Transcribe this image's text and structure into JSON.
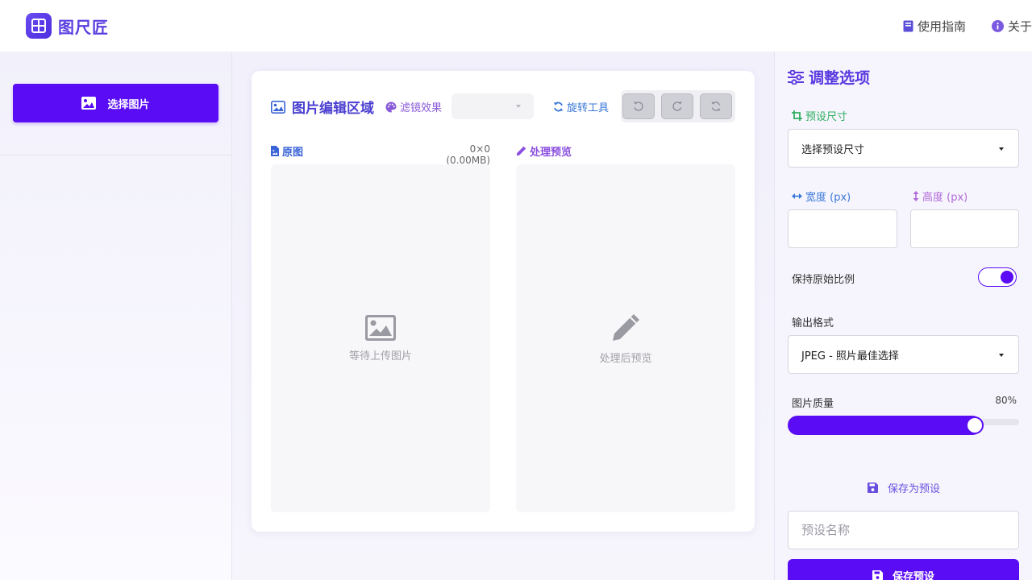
{
  "app": {
    "title": "图尺匠"
  },
  "nav": {
    "guide": "使用指南",
    "about": "关于"
  },
  "sidebar": {
    "select_image": "选择图片"
  },
  "editor": {
    "title": "图片编辑区域",
    "filter_label": "滤镜效果",
    "filter_value": "",
    "rotate_label": "旋转工具",
    "original": {
      "label": "原图",
      "info": "0×0 (0.00MB)",
      "placeholder": "等待上传图片"
    },
    "preview": {
      "label": "处理预览",
      "placeholder": "处理后预览"
    }
  },
  "options": {
    "title": "调整选项",
    "preset_size": {
      "label": "预设尺寸",
      "value": "选择预设尺寸"
    },
    "width": {
      "label": "宽度 (px)",
      "value": ""
    },
    "height": {
      "label": "高度 (px)",
      "value": ""
    },
    "keep_ratio": {
      "label": "保持原始比例",
      "checked": true
    },
    "output_format": {
      "label": "输出格式",
      "value": "JPEG - 照片最佳选择"
    },
    "quality": {
      "label": "图片质量",
      "value_text": "80%",
      "value": 0.8
    },
    "save_preset_link": "保存为预设",
    "preset_name": {
      "placeholder": "预设名称",
      "value": ""
    },
    "save_preset_button": "保存预设"
  },
  "colors": {
    "accent": "#5a0cf5",
    "title": "#5a3ae0",
    "preset_icon": "#2fae5f",
    "filter": "#8a5bd8",
    "rotate": "#3a78d8",
    "original": "#3a63d8",
    "preview": "#8a4fe0",
    "width_icon": "#3a78d8",
    "height_icon": "#b06ad8"
  },
  "icons": {
    "logo": "grid-icon",
    "guide": "book-icon",
    "about": "info-icon",
    "select": "image-icon",
    "editor": "image-icon",
    "filter": "palette-icon",
    "rotate": "sync-icon",
    "original": "file-image-icon",
    "preview": "pencil-icon",
    "options": "sliders-icon",
    "preset": "crop-icon",
    "width": "arrows-horizontal-icon",
    "height": "arrows-vertical-icon",
    "save": "floppy-disk-icon"
  }
}
